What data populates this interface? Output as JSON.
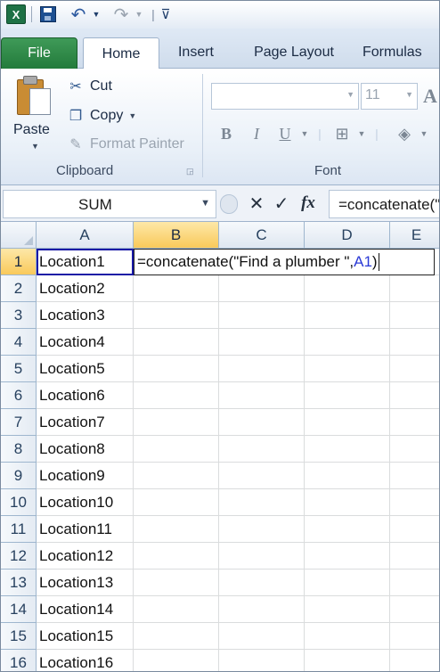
{
  "qat": {
    "app_icon_letter": "X",
    "separator_glyph": "|",
    "customize_glyph": "⊽"
  },
  "tabs": [
    "File",
    "Home",
    "Insert",
    "Page Layout",
    "Formulas"
  ],
  "clipboard": {
    "paste_label": "Paste",
    "cut_label": "Cut",
    "copy_label": "Copy",
    "format_painter_label": "Format Painter",
    "group_label": "Clipboard"
  },
  "font": {
    "font_name": "",
    "font_size": "11",
    "bold": "B",
    "italic": "I",
    "underline": "U",
    "group_label": "Font",
    "grow_font_glyph": "A"
  },
  "formula_bar": {
    "name_box": "SUM",
    "cancel_glyph": "✕",
    "enter_glyph": "✓",
    "fx_label": "fx",
    "formula_text": "=concatenate(\"Find a plumber \",A1)"
  },
  "grid": {
    "columns": [
      "A",
      "B",
      "C",
      "D",
      "E"
    ],
    "rows": [
      {
        "num": "1",
        "a": "Location1"
      },
      {
        "num": "2",
        "a": "Location2"
      },
      {
        "num": "3",
        "a": "Location3"
      },
      {
        "num": "4",
        "a": "Location4"
      },
      {
        "num": "5",
        "a": "Location5"
      },
      {
        "num": "6",
        "a": "Location6"
      },
      {
        "num": "7",
        "a": "Location7"
      },
      {
        "num": "8",
        "a": "Location8"
      },
      {
        "num": "9",
        "a": "Location9"
      },
      {
        "num": "10",
        "a": "Location10"
      },
      {
        "num": "11",
        "a": "Location11"
      },
      {
        "num": "12",
        "a": "Location12"
      },
      {
        "num": "13",
        "a": "Location13"
      },
      {
        "num": "14",
        "a": "Location14"
      },
      {
        "num": "15",
        "a": "Location15"
      },
      {
        "num": "16",
        "a": "Location16"
      }
    ],
    "b1_edit_prefix": "=concatenate(\"Find a plumber \",",
    "b1_edit_ref": "A1",
    "b1_edit_suffix": ")"
  },
  "colors": {
    "file_tab": "#237b3b",
    "active_header": "#f9c95a",
    "cell_reference": "#2b3ad6"
  }
}
